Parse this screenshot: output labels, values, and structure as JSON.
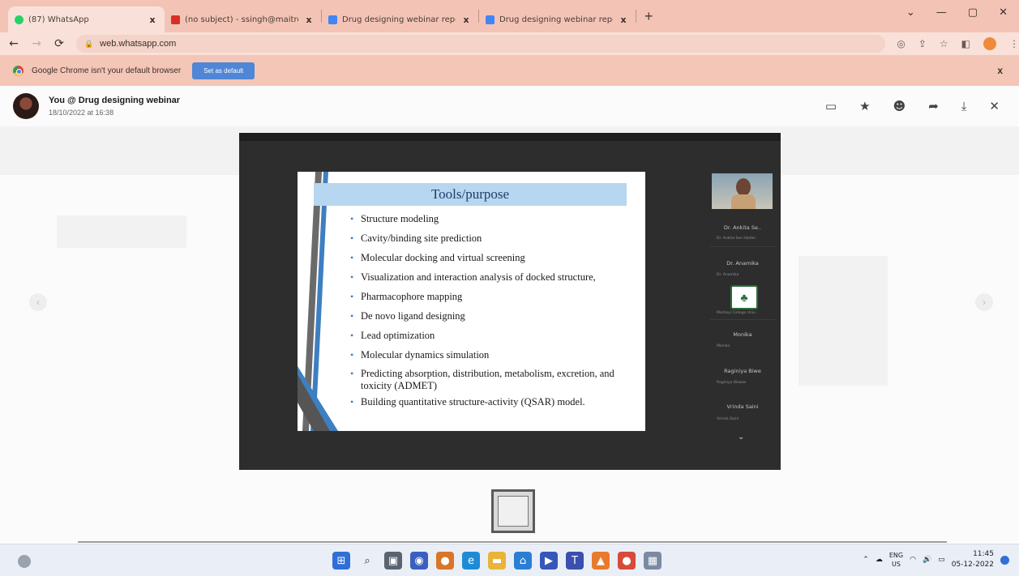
{
  "browser": {
    "tabs": [
      {
        "title": "(87) WhatsApp",
        "favicon_color": "#25d366",
        "active": true
      },
      {
        "title": "(no subject) - ssingh@maitreyi.c",
        "favicon_color": "#d93025",
        "active": false
      },
      {
        "title": "Drug designing webinar report",
        "favicon_color": "#4285f4",
        "active": false
      },
      {
        "title": "Drug designing webinar report",
        "favicon_color": "#4285f4",
        "active": false
      }
    ],
    "tab_close": "x",
    "new_tab": "+",
    "window_controls": {
      "dropdown": "⌄",
      "minimize": "—",
      "maximize": "▢",
      "close": "✕"
    },
    "url": "web.whatsapp.com",
    "infobar": {
      "message": "Google Chrome isn't your default browser",
      "button": "Set as default",
      "close": "x"
    }
  },
  "viewer": {
    "sender": "You @ Drug designing webinar",
    "timestamp": "18/10/2022 at 16:38",
    "actions": [
      "comment-icon",
      "star-icon",
      "emoji-icon",
      "forward-icon",
      "download-icon",
      "close-icon"
    ]
  },
  "slide": {
    "title": "Tools/purpose",
    "bullets": [
      "Structure modeling",
      "Cavity/binding site prediction",
      "Molecular docking and virtual screening",
      "Visualization and interaction analysis of docked structure,",
      "Pharmacophore mapping",
      "De novo ligand designing",
      "Lead optimization",
      "Molecular dynamics simulation",
      "Predicting absorption, distribution, metabolism, excretion, and toxicity (ADMET)",
      "Building quantitative structure-activity (QSAR) model."
    ]
  },
  "participants": [
    {
      "name": "",
      "sub": ""
    },
    {
      "name": "Dr. Ankita Se..",
      "sub": "Dr. Ankita Sen Halder"
    },
    {
      "name": "Dr. Anamika",
      "sub": "Dr. Anamika"
    },
    {
      "name": "",
      "sub": "Maitreyi College Univ.."
    },
    {
      "name": "Monika",
      "sub": "Monika"
    },
    {
      "name": "Raginiya Biwe",
      "sub": "Raginiya Biswas"
    },
    {
      "name": "Vrinda Saini",
      "sub": "Vrinda Saini"
    }
  ],
  "taskbar": {
    "language_line1": "ENG",
    "language_line2": "US",
    "time": "11:45",
    "date": "05-12-2022"
  },
  "colors": {
    "tabstrip": "#f3c4b6",
    "toolbar": "#f9e1d9",
    "infobar": "#f4c6b7",
    "slide_title_bar": "#b7d6ef",
    "slide_title_text": "#1b3f6d",
    "bullet": "#3e7fc1"
  }
}
